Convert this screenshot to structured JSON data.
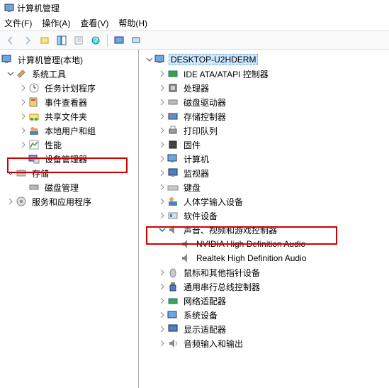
{
  "window": {
    "title": "计算机管理"
  },
  "menu": {
    "file": "文件(F)",
    "action": "操作(A)",
    "view": "查看(V)",
    "help": "帮助(H)"
  },
  "left_tree": {
    "root": "计算机管理(本地)",
    "system_tools": "系统工具",
    "task_scheduler": "任务计划程序",
    "event_viewer": "事件查看器",
    "shared_folders": "共享文件夹",
    "local_users": "本地用户和组",
    "performance": "性能",
    "device_manager": "设备管理器",
    "storage": "存储",
    "disk_management": "磁盘管理",
    "services": "服务和应用程序"
  },
  "right_tree": {
    "computer": "DESKTOP-U2HDERM",
    "ide": "IDE ATA/ATAPI 控制器",
    "processor": "处理器",
    "disk_drive": "磁盘驱动器",
    "storage_ctrl": "存储控制器",
    "print_queue": "打印队列",
    "firmware": "固件",
    "computer_cat": "计算机",
    "monitor": "监视器",
    "keyboard": "键盘",
    "hid": "人体学输入设备",
    "software": "软件设备",
    "sound": "声音、视频和游戏控制器",
    "sound_child1": "NVIDIA High Definition Audio",
    "sound_child2": "Realtek High Definition Audio",
    "mouse": "鼠标和其他指针设备",
    "usb": "通用串行总线控制器",
    "network": "网络适配器",
    "system_dev": "系统设备",
    "display": "显示适配器",
    "audio_io": "音频输入和输出"
  }
}
